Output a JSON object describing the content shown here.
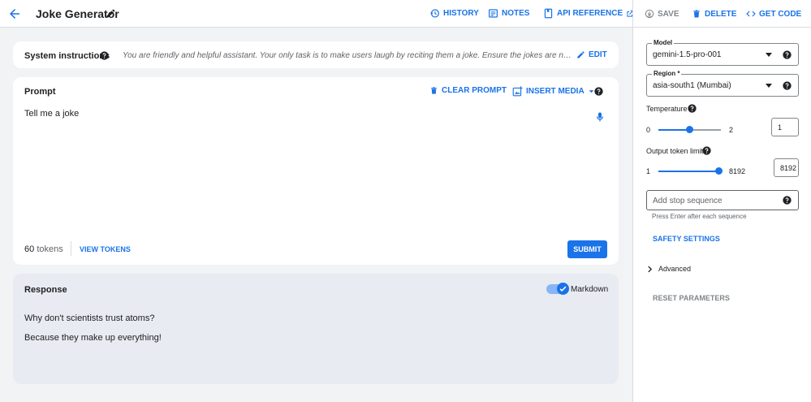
{
  "header": {
    "title": "Joke Generator",
    "history": "HISTORY",
    "notes": "NOTES",
    "api_reference": "API REFERENCE"
  },
  "actions": {
    "save": "SAVE",
    "delete": "DELETE",
    "get_code": "GET CODE"
  },
  "system": {
    "label": "System instructions",
    "text": "You are friendly and helpful assistant. Your only task is to make users laugh by reciting them a joke. Ensure the jokes are new every time.",
    "edit": "EDIT"
  },
  "prompt": {
    "title": "Prompt",
    "clear": "CLEAR PROMPT",
    "insert_media": "INSERT MEDIA",
    "text": "Tell me a joke",
    "token_count": "60",
    "token_suffix": "tokens",
    "view_tokens": "VIEW TOKENS",
    "submit": "SUBMIT"
  },
  "response": {
    "title": "Response",
    "markdown_label": "Markdown",
    "markdown_enabled": true,
    "lines": [
      "Why don't scientists trust atoms?",
      "Because they make up everything!"
    ]
  },
  "params": {
    "model_label": "Model",
    "model_value": "gemini-1.5-pro-001",
    "region_label": "Region *",
    "region_value": "asia-south1 (Mumbai)",
    "temperature_label": "Temperature",
    "temperature_min": "0",
    "temperature_max": "2",
    "temperature_value": "1",
    "temperature_level": 0.5,
    "output_label": "Output token limit",
    "output_min": "1",
    "output_max": "8192",
    "output_value": "8192",
    "output_level": 1.0,
    "stop_placeholder": "Add stop sequence",
    "stop_hint": "Press Enter after each sequence",
    "safety": "SAFETY SETTINGS",
    "advanced": "Advanced",
    "reset": "RESET PARAMETERS"
  },
  "colors": {
    "accent": "#1a73e8",
    "disabled": "#80868b"
  }
}
